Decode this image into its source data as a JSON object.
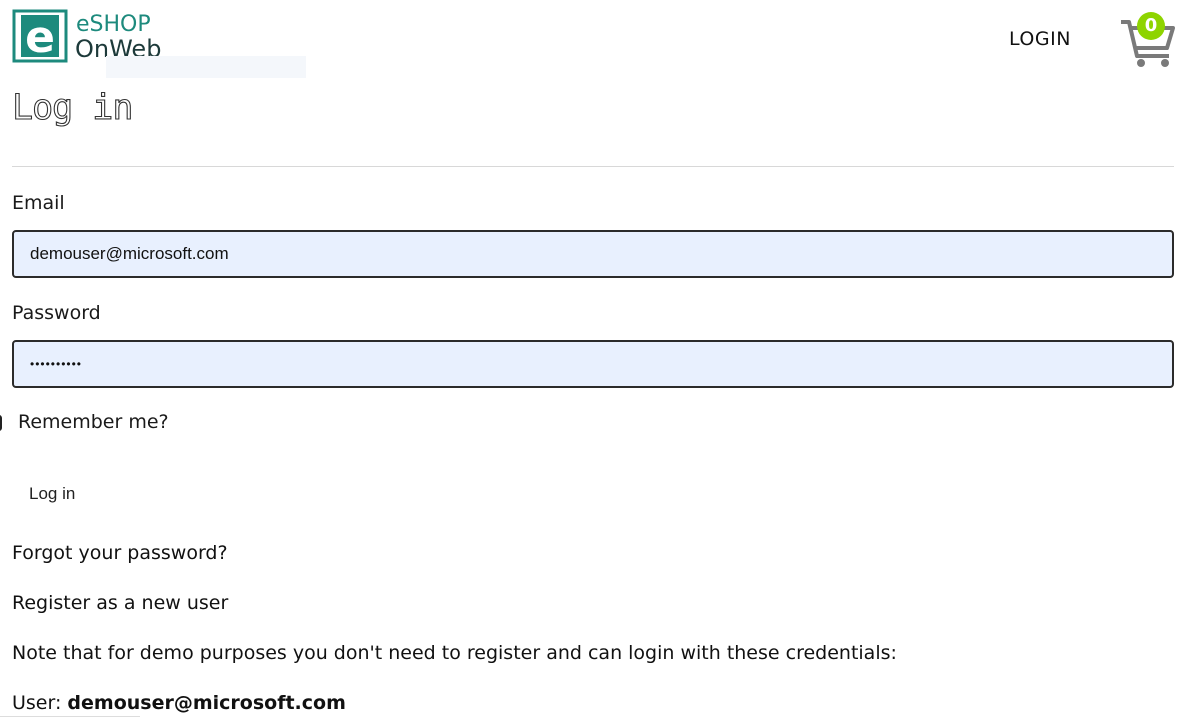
{
  "header": {
    "brand_line1": "eSHOP",
    "brand_line2": "OnWeb",
    "brand_letter": "e",
    "login_label": "LOGIN",
    "cart_count": "0",
    "cart_icon": "cart-icon",
    "colors": {
      "brand_teal": "#1d8a7d",
      "badge_green": "#8ed400"
    }
  },
  "main": {
    "title": "Log in",
    "email_label": "Email",
    "email_value": "demouser@microsoft.com",
    "password_label": "Password",
    "password_value": "••••••••••",
    "remember_label": "Remember me?",
    "submit_label": "Log in",
    "forgot_link": "Forgot your password?",
    "register_link": "Register as a new user",
    "note": "Note that for demo purposes you don't need to register and can login with these credentials:",
    "user_prefix": "User: ",
    "user_value": "demouser@microsoft.com"
  }
}
